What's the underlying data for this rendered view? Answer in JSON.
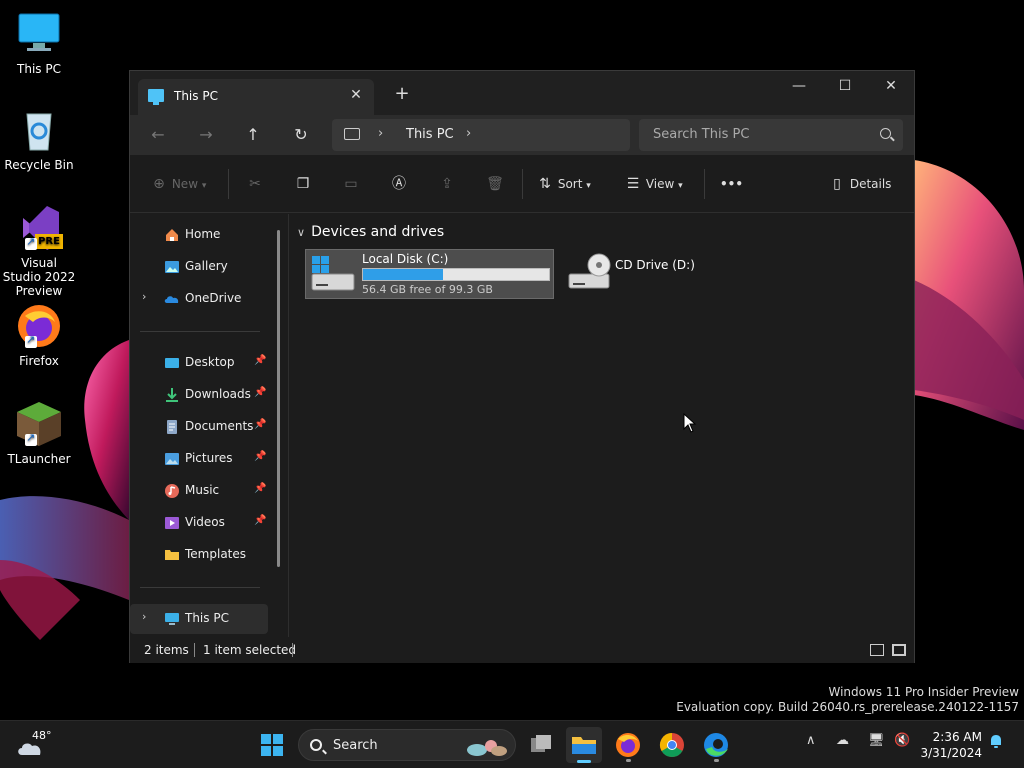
{
  "desktop": {
    "icons": [
      {
        "label": "This PC",
        "icon": "monitor-icon"
      },
      {
        "label": "Recycle Bin",
        "icon": "recycle-bin-icon"
      },
      {
        "label": "Visual Studio 2022 Preview",
        "badge": "PRE",
        "icon": "visual-studio-icon"
      },
      {
        "label": "Firefox",
        "icon": "firefox-icon"
      },
      {
        "label": "TLauncher",
        "icon": "minecraft-block-icon"
      }
    ]
  },
  "explorer": {
    "tab_title": "This PC",
    "new_tab": "+",
    "address": {
      "crumb": "This PC"
    },
    "search_placeholder": "Search This PC",
    "toolbar": {
      "new_label": "New",
      "sort_label": "Sort",
      "view_label": "View",
      "more_label": "•••",
      "details_label": "Details"
    },
    "sidebar": {
      "items": [
        {
          "label": "Home"
        },
        {
          "label": "Gallery"
        },
        {
          "label": "OneDrive"
        },
        {
          "label": "Desktop"
        },
        {
          "label": "Downloads"
        },
        {
          "label": "Documents"
        },
        {
          "label": "Pictures"
        },
        {
          "label": "Music"
        },
        {
          "label": "Videos"
        },
        {
          "label": "Templates"
        },
        {
          "label": "This PC"
        }
      ]
    },
    "content": {
      "group_header": "Devices and drives",
      "drives": [
        {
          "name": "Local Disk (C:)",
          "free_text": "56.4 GB free of 99.3 GB",
          "used_fraction": 0.432
        },
        {
          "name": "CD Drive (D:)"
        }
      ]
    },
    "status": {
      "items": "2 items",
      "selected": "1 item selected"
    }
  },
  "watermark": {
    "line1": "Windows 11 Pro Insider Preview",
    "line2": "Evaluation copy. Build 26040.rs_prerelease.240122-1157"
  },
  "taskbar": {
    "weather_temp": "48°",
    "search_label": "Search",
    "clock_time": "2:36 AM",
    "clock_date": "3/31/2024"
  },
  "colors": {
    "accent": "#60cdff",
    "drive_bar": "#2f9ee8"
  }
}
